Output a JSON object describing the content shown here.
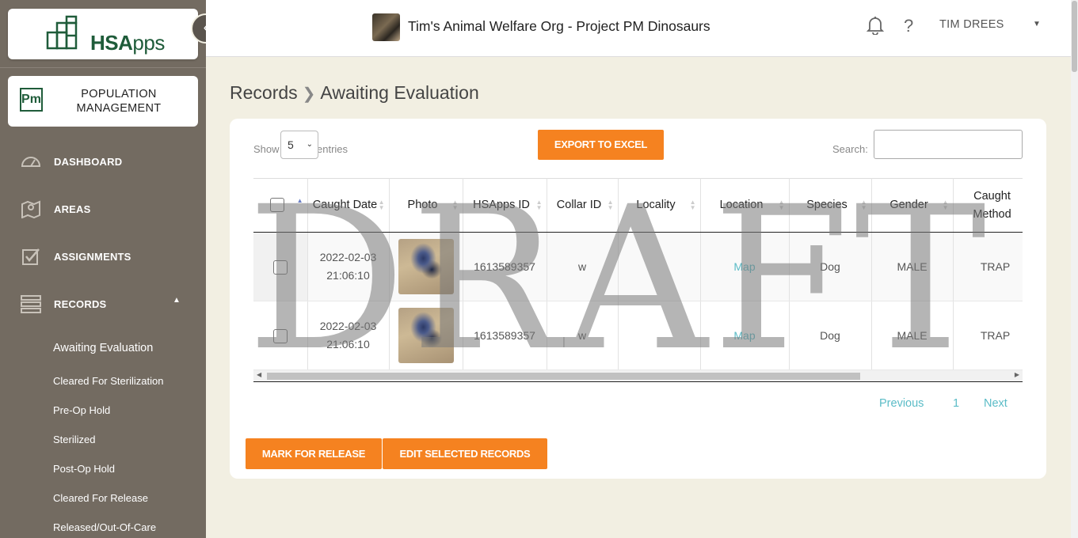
{
  "brand": {
    "logo_text_bold": "HSA",
    "logo_text_light": "pps"
  },
  "module": {
    "icon_text": "Pm",
    "label": "POPULATION MANAGEMENT"
  },
  "nav": [
    {
      "label": "DASHBOARD",
      "icon": "gauge-icon"
    },
    {
      "label": "AREAS",
      "icon": "map-icon"
    },
    {
      "label": "ASSIGNMENTS",
      "icon": "checkbox-icon"
    },
    {
      "label": "RECORDS",
      "icon": "records-icon"
    }
  ],
  "records_submenu": [
    "Awaiting Evaluation",
    "Cleared For Sterilization",
    "Pre-Op Hold",
    "Sterilized",
    "Post-Op Hold",
    "Cleared For Release",
    "Released/Out-Of-Care"
  ],
  "header": {
    "org_title": "Tim's Animal Welfare Org - Project PM Dinosaurs",
    "user_name": "TIM DREES"
  },
  "breadcrumb": {
    "parent": "Records",
    "current": "Awaiting Evaluation"
  },
  "table_controls": {
    "show_label": "Show",
    "entries_label": "entries",
    "page_length": "5",
    "export_label": "EXPORT TO EXCEL",
    "search_label": "Search:",
    "search_value": ""
  },
  "columns": [
    "Caught Date",
    "Photo",
    "HSApps ID",
    "Collar ID",
    "Locality",
    "Location",
    "Species",
    "Gender",
    "Caught Method"
  ],
  "rows": [
    {
      "date": "2022-02-03",
      "time": "21:06:10",
      "hsapps_id": "1613589357",
      "collar_id": "w",
      "locality": "",
      "location": "Map",
      "species": "Dog",
      "gender": "MALE",
      "caught_method": "TRAP"
    },
    {
      "date": "2022-02-03",
      "time": "21:06:10",
      "hsapps_id": "1613589357",
      "collar_id": "w",
      "locality": "",
      "location": "Map",
      "species": "Dog",
      "gender": "MALE",
      "caught_method": "TRAP"
    }
  ],
  "pagination": {
    "previous": "Previous",
    "page": "1",
    "next": "Next"
  },
  "actions": {
    "mark_release": "MARK FOR RELEASE",
    "edit_selected": "EDIT SELECTED RECORDS"
  },
  "watermark": "DRAFT",
  "colors": {
    "accent": "#f58220",
    "sidebar": "#736b61",
    "link": "#5bbcc7",
    "brand_green": "#1f5c3a"
  }
}
